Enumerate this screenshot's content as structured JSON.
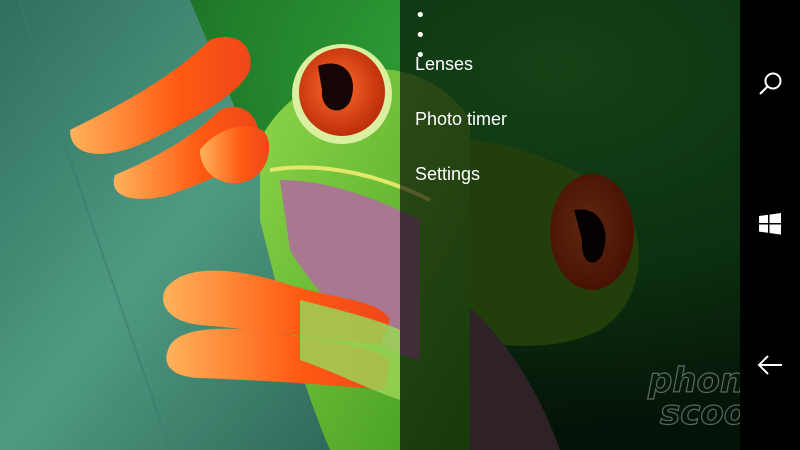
{
  "menu": {
    "more_symbol": "• • •",
    "items": [
      {
        "label": "Lenses"
      },
      {
        "label": "Photo timer"
      },
      {
        "label": "Settings"
      }
    ]
  },
  "nav": {
    "search_icon": "search-icon",
    "start_icon": "windows-start-icon",
    "back_icon": "back-arrow-icon"
  },
  "watermark": {
    "line1": "phone",
    "line2": "scoop"
  },
  "colors": {
    "leaf": "#4e8d78",
    "frog_green": "#59b52a",
    "frog_orange": "#ff5a14",
    "eye_red": "#e23a10"
  }
}
